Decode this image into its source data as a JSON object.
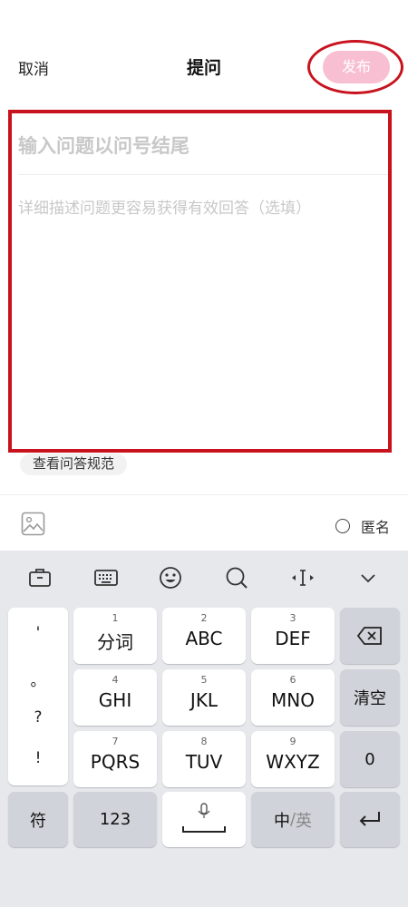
{
  "header": {
    "cancel": "取消",
    "title": "提问",
    "publish": "发布"
  },
  "editor": {
    "title_placeholder": "输入问题以问号结尾",
    "desc_placeholder": "详细描述问题更容易获得有效回答（选填）"
  },
  "rules_link": "查看问答规范",
  "tools": {
    "image_icon": "image-icon",
    "anonymous_label": "匿名"
  },
  "keyboard": {
    "toolbar_icons": [
      "briefcase-icon",
      "keyboard-icon",
      "emoji-icon",
      "search-icon",
      "cursor-icon",
      "collapse-icon"
    ],
    "punctuation": [
      "'",
      "。",
      "?",
      "!"
    ],
    "keys": [
      {
        "num": "1",
        "label": "分词"
      },
      {
        "num": "2",
        "label": "ABC"
      },
      {
        "num": "3",
        "label": "DEF"
      },
      {
        "num": "4",
        "label": "GHI"
      },
      {
        "num": "5",
        "label": "JKL"
      },
      {
        "num": "6",
        "label": "MNO"
      },
      {
        "num": "7",
        "label": "PQRS"
      },
      {
        "num": "8",
        "label": "TUV"
      },
      {
        "num": "9",
        "label": "WXYZ"
      }
    ],
    "backspace_icon": "backspace-icon",
    "clear": "清空",
    "zero": "0",
    "symbols": "符",
    "numbers": "123",
    "mic_icon": "microphone-icon",
    "lang_cn": "中",
    "lang_sep": "/",
    "lang_en": "英",
    "enter_icon": "enter-icon"
  },
  "colors": {
    "accent_red": "#c8121e",
    "publish_pink": "#f8bfd2",
    "keyboard_bg": "#e7e8ec"
  }
}
